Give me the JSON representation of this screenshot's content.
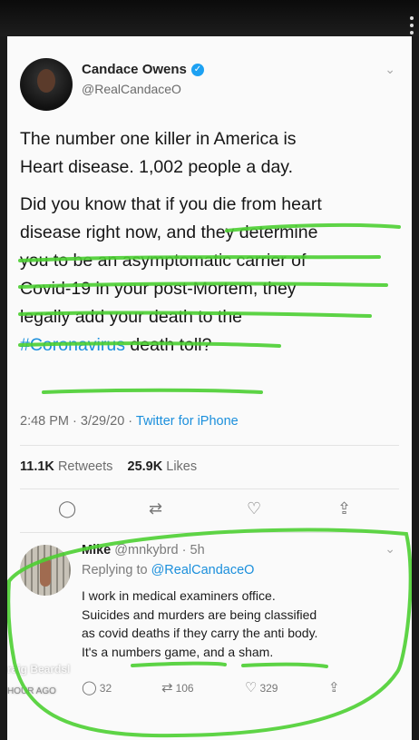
{
  "tweet": {
    "author_name": "Candace Owens",
    "author_handle": "@RealCandaceO",
    "paragraph1_lines": [
      "The number one killer in America is",
      "Heart disease. 1,002 people a day."
    ],
    "paragraph2_lines": [
      "Did you know that if you die from heart",
      "disease right now, and they determine",
      "you to be an asymptomatic carrier of",
      "Covid-19 in your post-Mortem, they",
      "legally add your death to the"
    ],
    "hashtag": "#Coronavirus",
    "last_line_tail": " death toll?",
    "time": "2:48 PM",
    "date": "3/29/20",
    "source": "Twitter for iPhone",
    "retweets_count": "11.1K",
    "retweets_label": "Retweets",
    "likes_count": "25.9K",
    "likes_label": "Likes"
  },
  "reply": {
    "author_name": "Mike",
    "author_handle": "@mnkybrd",
    "age": "5h",
    "replying_to_label": "Replying to",
    "replying_to_handle": "@RealCandaceO",
    "lines": [
      "I work in medical examiners office.",
      "Suicides and murders are being classified",
      "as covid deaths if they carry the anti body.",
      "It's a numbers game, and a sham."
    ],
    "reply_count": "32",
    "retweet_count": "106",
    "like_count": "329"
  },
  "watermark": {
    "name": "raig Beardsl",
    "time": "HOUR AGO"
  },
  "icons": [
    "verified-icon",
    "chevron-down-icon",
    "reply-icon",
    "retweet-icon",
    "like-icon",
    "share-icon"
  ],
  "colors": {
    "link": "#1b8fdc",
    "verified": "#1da1f2",
    "annotation": "#4ccf32"
  }
}
